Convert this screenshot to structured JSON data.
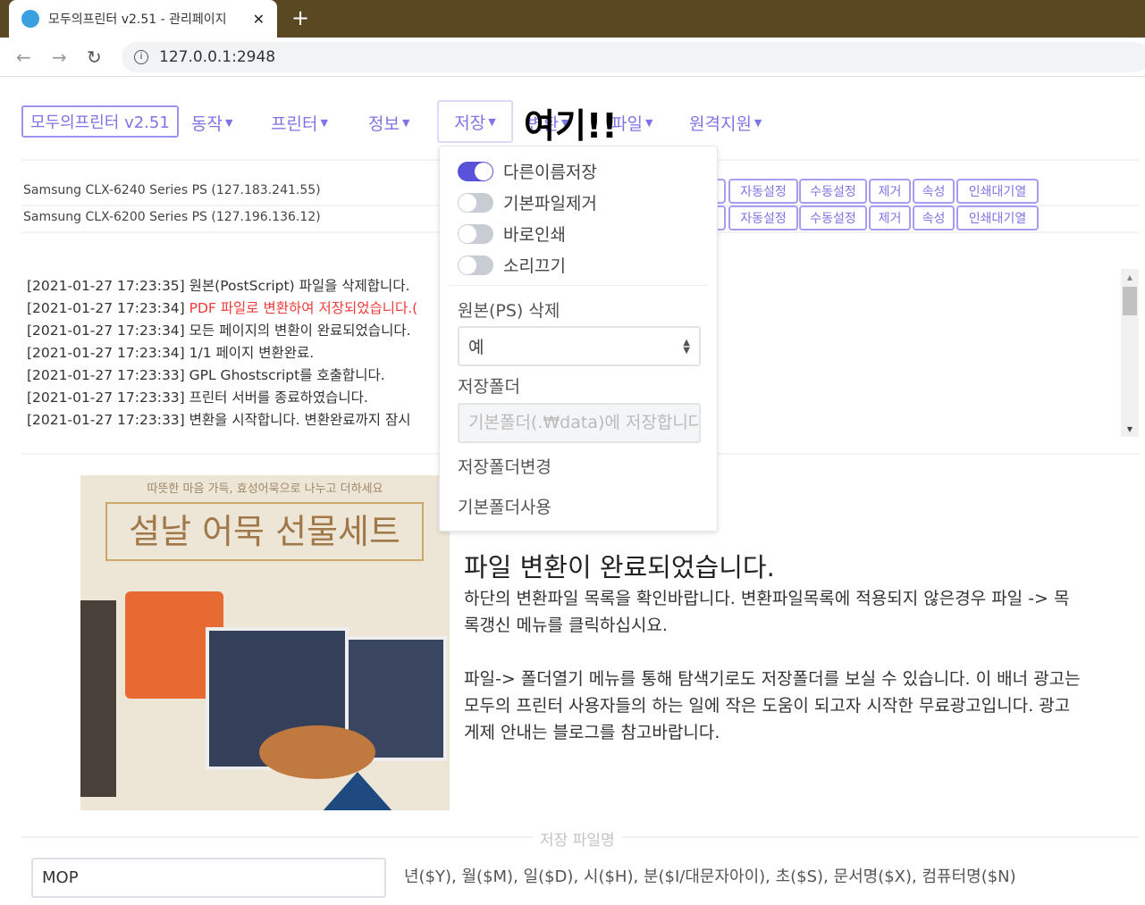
{
  "browser": {
    "tab_title": "모두의프린터 v2.51 - 관리페이지",
    "url": "127.0.0.1:2948"
  },
  "nav": {
    "brand": "모두의프린터 v2.51",
    "items": [
      "동작",
      "프린터",
      "정보",
      "저장",
      "변환",
      "파일",
      "원격지원"
    ],
    "annotation": "여기!!"
  },
  "printers": [
    {
      "name": "Samsung CLX-6240 Series PS (127.183.241.55)"
    },
    {
      "name": "Samsung CLX-6200 Series PS (127.196.136.12)"
    }
  ],
  "printer_buttons": [
    "자동설정",
    "수동설정",
    "제거",
    "속성",
    "인쇄대기열"
  ],
  "log": [
    {
      "text": "[2021-01-27 17:23:35] 원본(PostScript) 파일을 삭제합니다.",
      "time": "",
      "msg": ""
    },
    {
      "time": "[2021-01-27 17:23:34] ",
      "msg": "PDF 파일로 변환하여 저장되었습니다.("
    },
    {
      "text": "[2021-01-27 17:23:34] 모든 페이지의 변환이 완료되었습니다."
    },
    {
      "text": "[2021-01-27 17:23:34] 1/1 페이지 변환완료."
    },
    {
      "text": "[2021-01-27 17:23:33] GPL Ghostscript를 호출합니다."
    },
    {
      "text": "[2021-01-27 17:23:33] 프린터 서버를 종료하였습니다."
    },
    {
      "text": "[2021-01-27 17:23:33] 변환을 시작합니다. 변환완료까지 잠시"
    }
  ],
  "save_menu": {
    "toggles": [
      {
        "label": "다른이름저장",
        "on": true
      },
      {
        "label": "기본파일제거",
        "on": false
      },
      {
        "label": "바로인쇄",
        "on": false
      },
      {
        "label": "소리끄기",
        "on": false
      }
    ],
    "delete_label": "원본(PS) 삭제",
    "delete_value": "예",
    "folder_label": "저장폴더",
    "folder_placeholder": "기본폴더(.₩data)에 저장합니다",
    "change_folder": "저장폴더변경",
    "default_folder": "기본폴더사용"
  },
  "ad": {
    "subtitle": "따뜻한 마음 가득, 효성어묵으로 나누고 더하세요",
    "title": "설날 어묵 선물세트"
  },
  "main": {
    "headline": "파일 변환이 완료되었습니다.",
    "p1": "하단의 변환파일 목록을 확인바랍니다. 변환파일목록에 적용되지 않은경우 파일 -> 목록갱신 메뉴를 클릭하십시요.",
    "p2": "파일-> 폴더열기 메뉴를 통해 탐색기로도 저장폴더를 보실 수 있습니다. 이 배너 광고는 모두의 프린터 사용자들의 하는 일에 작은 도움이 되고자 시작한 무료광고입니다. 광고 게제 안내는 블로그를 참고바랍니다."
  },
  "filename": {
    "legend": "저장 파일명",
    "value": "MOP",
    "hint": "년($Y), 월($M), 일($D), 시($H), 분($I/대문자아이), 초($S), 문서명($X), 컴퓨터명($N)"
  },
  "colors": {
    "accent": "#7d74e6",
    "toggle_on": "#5a52d8",
    "log_error": "#f03a3a",
    "tabbar": "#5a4822"
  }
}
